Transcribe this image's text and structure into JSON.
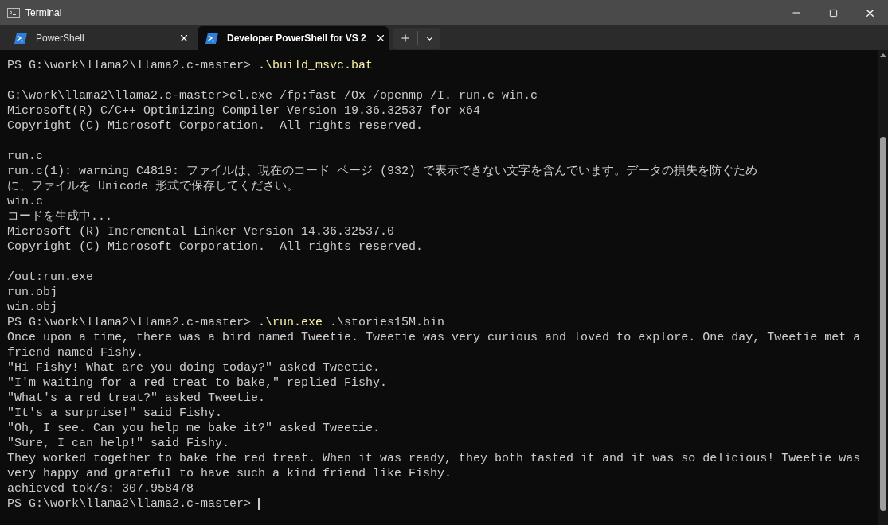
{
  "window": {
    "title": "Terminal"
  },
  "tabs": [
    {
      "label": "PowerShell",
      "selected": false
    },
    {
      "label": "Developer PowerShell for VS 2",
      "selected": true
    }
  ],
  "lines": [
    {
      "kind": "prompt",
      "prompt": "PS G:\\work\\llama2\\llama2.c-master>",
      "command": ".\\build_msvc.bat"
    },
    {
      "kind": "blank"
    },
    {
      "kind": "output",
      "text": "G:\\work\\llama2\\llama2.c-master>cl.exe /fp:fast /Ox /openmp /I. run.c win.c"
    },
    {
      "kind": "output",
      "text": "Microsoft(R) C/C++ Optimizing Compiler Version 19.36.32537 for x64"
    },
    {
      "kind": "output",
      "text": "Copyright (C) Microsoft Corporation.  All rights reserved."
    },
    {
      "kind": "blank"
    },
    {
      "kind": "output",
      "text": "run.c"
    },
    {
      "kind": "output",
      "text": "run.c(1): warning C4819: ファイルは、現在のコード ページ (932) で表示できない文字を含んでいます。データの損失を防ぐため"
    },
    {
      "kind": "output",
      "text": "に、ファイルを Unicode 形式で保存してください。"
    },
    {
      "kind": "output",
      "text": "win.c"
    },
    {
      "kind": "output",
      "text": "コードを生成中..."
    },
    {
      "kind": "output",
      "text": "Microsoft (R) Incremental Linker Version 14.36.32537.0"
    },
    {
      "kind": "output",
      "text": "Copyright (C) Microsoft Corporation.  All rights reserved."
    },
    {
      "kind": "blank"
    },
    {
      "kind": "output",
      "text": "/out:run.exe"
    },
    {
      "kind": "output",
      "text": "run.obj"
    },
    {
      "kind": "output",
      "text": "win.obj"
    },
    {
      "kind": "prompt",
      "prompt": "PS G:\\work\\llama2\\llama2.c-master>",
      "command": ".\\run.exe",
      "args": ".\\stories15M.bin"
    },
    {
      "kind": "output",
      "text": "Once upon a time, there was a bird named Tweetie. Tweetie was very curious and loved to explore. One day, Tweetie met a"
    },
    {
      "kind": "output",
      "text": "friend named Fishy."
    },
    {
      "kind": "output",
      "text": "\"Hi Fishy! What are you doing today?\" asked Tweetie."
    },
    {
      "kind": "output",
      "text": "\"I'm waiting for a red treat to bake,\" replied Fishy."
    },
    {
      "kind": "output",
      "text": "\"What's a red treat?\" asked Tweetie."
    },
    {
      "kind": "output",
      "text": "\"It's a surprise!\" said Fishy."
    },
    {
      "kind": "output",
      "text": "\"Oh, I see. Can you help me bake it?\" asked Tweetie."
    },
    {
      "kind": "output",
      "text": "\"Sure, I can help!\" said Fishy."
    },
    {
      "kind": "output",
      "text": "They worked together to bake the red treat. When it was ready, they both tasted it and it was so delicious! Tweetie was"
    },
    {
      "kind": "output",
      "text": "very happy and grateful to have such a kind friend like Fishy."
    },
    {
      "kind": "output",
      "text": "achieved tok/s: 307.958478"
    },
    {
      "kind": "prompt",
      "prompt": "PS G:\\work\\llama2\\llama2.c-master>",
      "cursor": true
    }
  ]
}
